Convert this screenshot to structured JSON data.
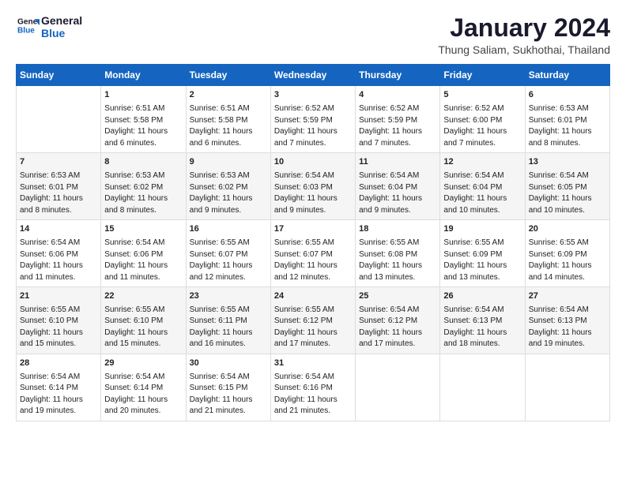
{
  "logo": {
    "line1": "General",
    "line2": "Blue"
  },
  "header": {
    "title": "January 2024",
    "location": "Thung Saliam, Sukhothai, Thailand"
  },
  "weekdays": [
    "Sunday",
    "Monday",
    "Tuesday",
    "Wednesday",
    "Thursday",
    "Friday",
    "Saturday"
  ],
  "weeks": [
    [
      {
        "day": "",
        "info": ""
      },
      {
        "day": "1",
        "info": "Sunrise: 6:51 AM\nSunset: 5:58 PM\nDaylight: 11 hours\nand 6 minutes."
      },
      {
        "day": "2",
        "info": "Sunrise: 6:51 AM\nSunset: 5:58 PM\nDaylight: 11 hours\nand 6 minutes."
      },
      {
        "day": "3",
        "info": "Sunrise: 6:52 AM\nSunset: 5:59 PM\nDaylight: 11 hours\nand 7 minutes."
      },
      {
        "day": "4",
        "info": "Sunrise: 6:52 AM\nSunset: 5:59 PM\nDaylight: 11 hours\nand 7 minutes."
      },
      {
        "day": "5",
        "info": "Sunrise: 6:52 AM\nSunset: 6:00 PM\nDaylight: 11 hours\nand 7 minutes."
      },
      {
        "day": "6",
        "info": "Sunrise: 6:53 AM\nSunset: 6:01 PM\nDaylight: 11 hours\nand 8 minutes."
      }
    ],
    [
      {
        "day": "7",
        "info": "Sunrise: 6:53 AM\nSunset: 6:01 PM\nDaylight: 11 hours\nand 8 minutes."
      },
      {
        "day": "8",
        "info": "Sunrise: 6:53 AM\nSunset: 6:02 PM\nDaylight: 11 hours\nand 8 minutes."
      },
      {
        "day": "9",
        "info": "Sunrise: 6:53 AM\nSunset: 6:02 PM\nDaylight: 11 hours\nand 9 minutes."
      },
      {
        "day": "10",
        "info": "Sunrise: 6:54 AM\nSunset: 6:03 PM\nDaylight: 11 hours\nand 9 minutes."
      },
      {
        "day": "11",
        "info": "Sunrise: 6:54 AM\nSunset: 6:04 PM\nDaylight: 11 hours\nand 9 minutes."
      },
      {
        "day": "12",
        "info": "Sunrise: 6:54 AM\nSunset: 6:04 PM\nDaylight: 11 hours\nand 10 minutes."
      },
      {
        "day": "13",
        "info": "Sunrise: 6:54 AM\nSunset: 6:05 PM\nDaylight: 11 hours\nand 10 minutes."
      }
    ],
    [
      {
        "day": "14",
        "info": "Sunrise: 6:54 AM\nSunset: 6:06 PM\nDaylight: 11 hours\nand 11 minutes."
      },
      {
        "day": "15",
        "info": "Sunrise: 6:54 AM\nSunset: 6:06 PM\nDaylight: 11 hours\nand 11 minutes."
      },
      {
        "day": "16",
        "info": "Sunrise: 6:55 AM\nSunset: 6:07 PM\nDaylight: 11 hours\nand 12 minutes."
      },
      {
        "day": "17",
        "info": "Sunrise: 6:55 AM\nSunset: 6:07 PM\nDaylight: 11 hours\nand 12 minutes."
      },
      {
        "day": "18",
        "info": "Sunrise: 6:55 AM\nSunset: 6:08 PM\nDaylight: 11 hours\nand 13 minutes."
      },
      {
        "day": "19",
        "info": "Sunrise: 6:55 AM\nSunset: 6:09 PM\nDaylight: 11 hours\nand 13 minutes."
      },
      {
        "day": "20",
        "info": "Sunrise: 6:55 AM\nSunset: 6:09 PM\nDaylight: 11 hours\nand 14 minutes."
      }
    ],
    [
      {
        "day": "21",
        "info": "Sunrise: 6:55 AM\nSunset: 6:10 PM\nDaylight: 11 hours\nand 15 minutes."
      },
      {
        "day": "22",
        "info": "Sunrise: 6:55 AM\nSunset: 6:10 PM\nDaylight: 11 hours\nand 15 minutes."
      },
      {
        "day": "23",
        "info": "Sunrise: 6:55 AM\nSunset: 6:11 PM\nDaylight: 11 hours\nand 16 minutes."
      },
      {
        "day": "24",
        "info": "Sunrise: 6:55 AM\nSunset: 6:12 PM\nDaylight: 11 hours\nand 17 minutes."
      },
      {
        "day": "25",
        "info": "Sunrise: 6:54 AM\nSunset: 6:12 PM\nDaylight: 11 hours\nand 17 minutes."
      },
      {
        "day": "26",
        "info": "Sunrise: 6:54 AM\nSunset: 6:13 PM\nDaylight: 11 hours\nand 18 minutes."
      },
      {
        "day": "27",
        "info": "Sunrise: 6:54 AM\nSunset: 6:13 PM\nDaylight: 11 hours\nand 19 minutes."
      }
    ],
    [
      {
        "day": "28",
        "info": "Sunrise: 6:54 AM\nSunset: 6:14 PM\nDaylight: 11 hours\nand 19 minutes."
      },
      {
        "day": "29",
        "info": "Sunrise: 6:54 AM\nSunset: 6:14 PM\nDaylight: 11 hours\nand 20 minutes."
      },
      {
        "day": "30",
        "info": "Sunrise: 6:54 AM\nSunset: 6:15 PM\nDaylight: 11 hours\nand 21 minutes."
      },
      {
        "day": "31",
        "info": "Sunrise: 6:54 AM\nSunset: 6:16 PM\nDaylight: 11 hours\nand 21 minutes."
      },
      {
        "day": "",
        "info": ""
      },
      {
        "day": "",
        "info": ""
      },
      {
        "day": "",
        "info": ""
      }
    ]
  ]
}
